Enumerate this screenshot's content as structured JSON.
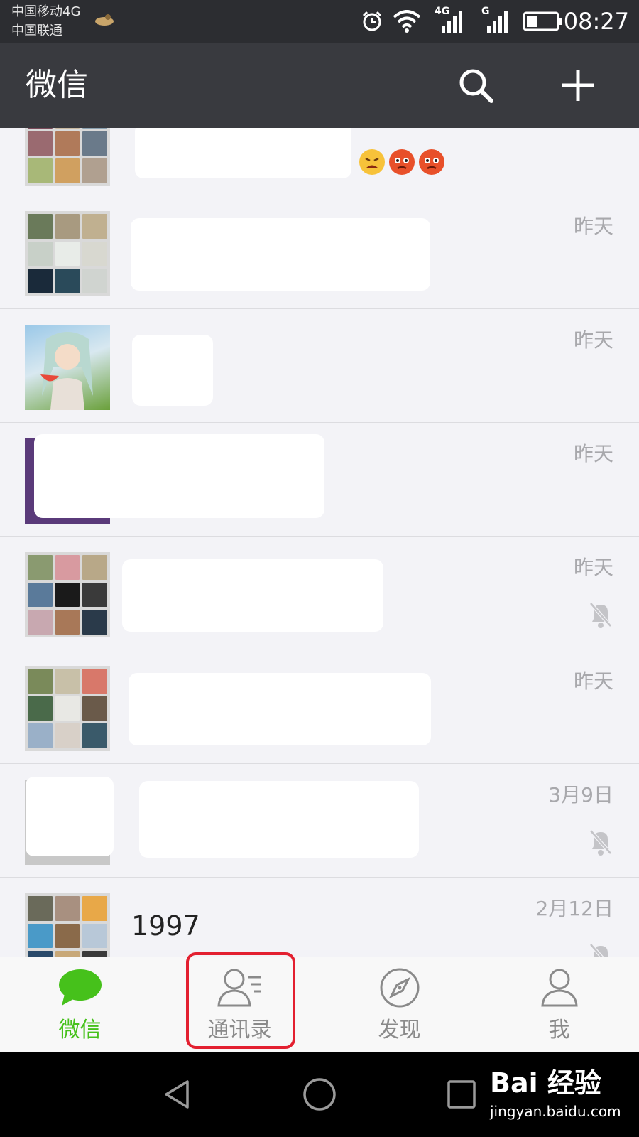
{
  "status_bar": {
    "carrier_1": "中国移动4G",
    "carrier_2": "中国联通",
    "network_1": "4G",
    "network_2": "G",
    "time": "08:27"
  },
  "app_bar": {
    "title": "微信",
    "icons": [
      "search-icon",
      "plus-icon"
    ]
  },
  "chats": [
    {
      "name": "",
      "time": "",
      "muted": false,
      "emoji_count": 3
    },
    {
      "name": "",
      "time": "昨天",
      "muted": false
    },
    {
      "name": "",
      "time": "昨天",
      "muted": false
    },
    {
      "name": "",
      "time": "昨天",
      "muted": false
    },
    {
      "name": "",
      "time": "昨天",
      "muted": true
    },
    {
      "name": "",
      "time": "昨天",
      "muted": false
    },
    {
      "name": "",
      "time": "3月9日",
      "muted": true
    },
    {
      "name": "1997",
      "time": "2月12日",
      "muted": true
    }
  ],
  "tab_bar": {
    "tabs": [
      {
        "label": "微信",
        "icon": "chat-bubble-icon",
        "active": true
      },
      {
        "label": "通讯录",
        "icon": "contacts-icon",
        "active": false,
        "highlighted": true
      },
      {
        "label": "发现",
        "icon": "compass-icon",
        "active": false
      },
      {
        "label": "我",
        "icon": "person-icon",
        "active": false
      }
    ]
  },
  "watermark": {
    "brand": "Bai 经验",
    "url": "jingyan.baidu.com"
  },
  "colors": {
    "status_bar": "#2c2d31",
    "app_bar": "#393a3f",
    "list_bg": "#f3f3f7",
    "accent_green": "#46c11b",
    "highlight_red": "#e32030"
  }
}
